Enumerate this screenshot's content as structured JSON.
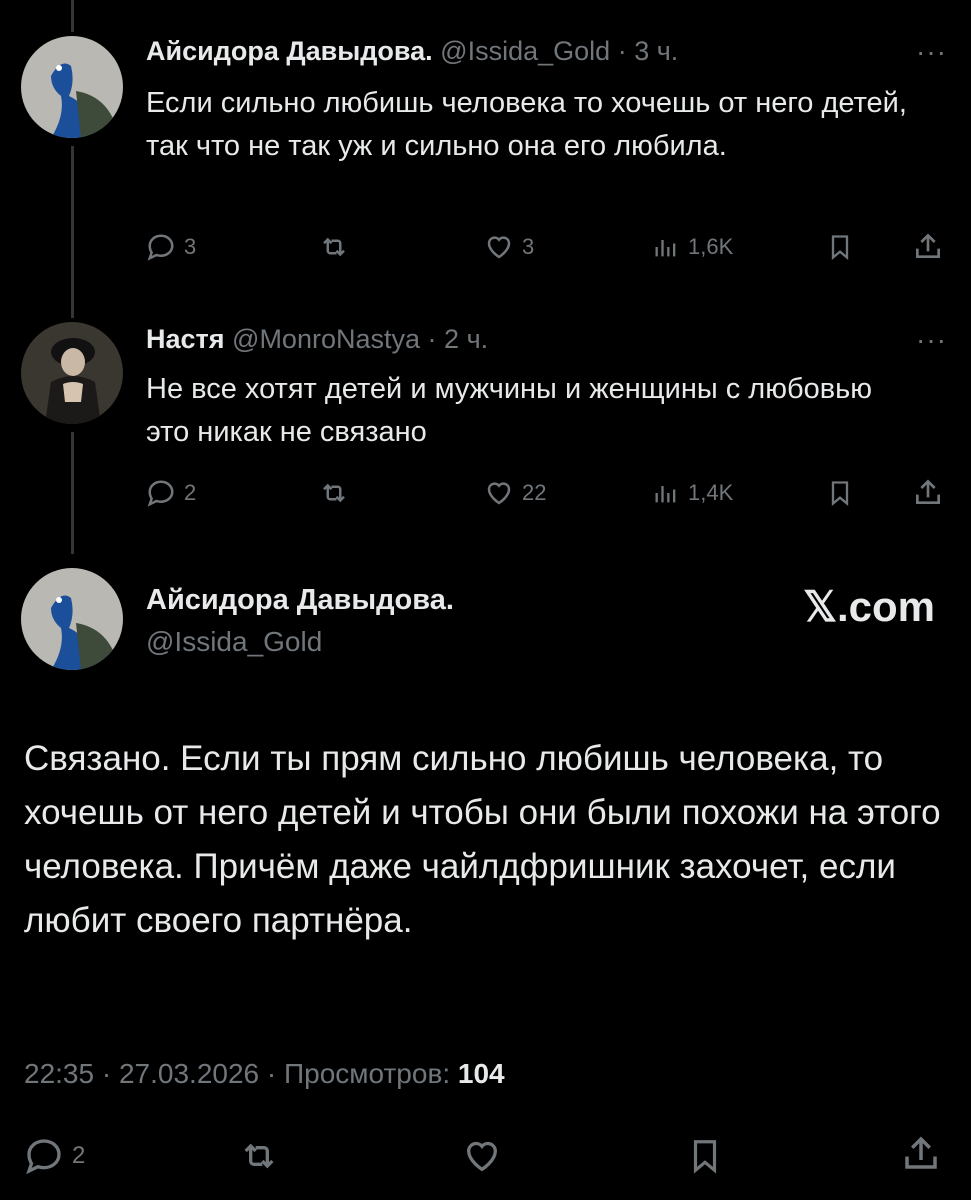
{
  "tweets": [
    {
      "name": "Айсидора Давыдова.",
      "handle": "@Issida_Gold",
      "time": "3 ч.",
      "text": "Если сильно любишь человека то хочешь от него детей, так что не так уж и сильно она его любила.",
      "replies": "3",
      "likes": "3",
      "views": "1,6K"
    },
    {
      "name": "Настя",
      "handle": "@MonroNastya",
      "time": "2 ч.",
      "text": "Не все хотят детей и мужчины и женщины с любовью это никак не связано",
      "replies": "2",
      "likes": "22",
      "views": "1,4K"
    }
  ],
  "main": {
    "name": "Айсидора Давыдова.",
    "handle": "@Issida_Gold",
    "brand": "𝕏.com",
    "text": "Связано. Если ты прям сильно любишь человека, то хочешь от него детей и чтобы они были похожи на этого человека. Причём даже чайлдфришник захочет, если любит своего партнёра.",
    "time": "22:35",
    "date": "27.03.2026",
    "views_label": "Просмотров:",
    "views": "104",
    "replies": "2"
  },
  "separator": "·",
  "more_glyph": "···",
  "colors": {
    "background": "#000000",
    "text": "#e7e9ea",
    "muted": "#71767b",
    "line": "#333639"
  },
  "icons": [
    "reply-icon",
    "retweet-icon",
    "like-icon",
    "views-icon",
    "bookmark-icon",
    "share-icon",
    "more-icon"
  ]
}
